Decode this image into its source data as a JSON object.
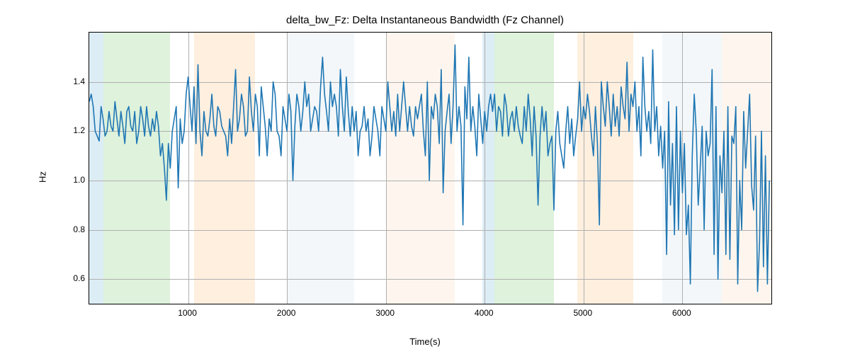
{
  "chart_data": {
    "type": "line",
    "title": "delta_bw_Fz: Delta Instantaneous Bandwidth (Fz Channel)",
    "xlabel": "Time(s)",
    "ylabel": "Hz",
    "xlim": [
      0,
      6900
    ],
    "ylim": [
      0.5,
      1.6
    ],
    "xticks": [
      1000,
      2000,
      3000,
      4000,
      5000,
      6000
    ],
    "yticks": [
      0.6,
      0.8,
      1.0,
      1.2,
      1.4
    ],
    "shaded_regions": [
      {
        "x0": 0,
        "x1": 140,
        "color": "#9ecae1"
      },
      {
        "x0": 140,
        "x1": 820,
        "color": "#a1d99b"
      },
      {
        "x0": 1060,
        "x1": 1680,
        "color": "#fdd0a2"
      },
      {
        "x0": 2000,
        "x1": 2680,
        "color": "#dce7ef"
      },
      {
        "x0": 3000,
        "x1": 3700,
        "color": "#fde6cf"
      },
      {
        "x0": 3980,
        "x1": 4100,
        "color": "#9ecae1"
      },
      {
        "x0": 4100,
        "x1": 4700,
        "color": "#a1d99b"
      },
      {
        "x0": 4940,
        "x1": 5500,
        "color": "#fdd0a2"
      },
      {
        "x0": 5800,
        "x1": 6400,
        "color": "#dce7ef"
      },
      {
        "x0": 6400,
        "x1": 6900,
        "color": "#fde6cf"
      }
    ],
    "series": [
      {
        "name": "delta_bw_Fz",
        "color": "#1f77b4",
        "x_step": 20,
        "values": [
          1.32,
          1.35,
          1.3,
          1.2,
          1.18,
          1.16,
          1.3,
          1.25,
          1.18,
          1.2,
          1.28,
          1.22,
          1.2,
          1.32,
          1.25,
          1.18,
          1.28,
          1.22,
          1.15,
          1.28,
          1.3,
          1.22,
          1.2,
          1.28,
          1.15,
          1.2,
          1.3,
          1.25,
          1.18,
          1.3,
          1.22,
          1.18,
          1.25,
          1.2,
          1.28,
          1.22,
          1.1,
          1.15,
          1.05,
          0.92,
          1.15,
          1.05,
          1.2,
          1.25,
          1.3,
          0.97,
          1.25,
          1.15,
          1.2,
          1.35,
          1.42,
          1.3,
          1.2,
          1.38,
          1.15,
          1.47,
          1.2,
          1.1,
          1.28,
          1.2,
          1.18,
          1.25,
          1.35,
          1.22,
          1.18,
          1.3,
          1.28,
          1.22,
          1.2,
          1.18,
          1.1,
          1.25,
          1.15,
          1.3,
          1.45,
          1.2,
          1.25,
          1.35,
          1.3,
          1.18,
          1.2,
          1.42,
          1.28,
          1.2,
          1.35,
          1.3,
          1.1,
          1.38,
          1.3,
          1.22,
          1.1,
          1.25,
          1.2,
          1.4,
          1.35,
          1.2,
          1.18,
          1.1,
          1.3,
          1.25,
          1.2,
          1.35,
          1.28,
          1.0,
          1.22,
          1.35,
          1.3,
          1.2,
          1.28,
          1.4,
          1.3,
          1.35,
          1.2,
          1.25,
          1.3,
          1.28,
          1.2,
          1.38,
          1.5,
          1.35,
          1.28,
          1.2,
          1.4,
          1.3,
          1.35,
          1.3,
          1.18,
          1.45,
          1.3,
          1.2,
          1.42,
          1.28,
          1.18,
          1.3,
          1.2,
          1.28,
          1.1,
          1.2,
          1.22,
          1.3,
          1.2,
          1.25,
          1.1,
          1.18,
          1.3,
          1.25,
          1.2,
          1.1,
          1.3,
          1.25,
          1.2,
          1.4,
          1.3,
          1.2,
          1.28,
          1.18,
          1.35,
          1.2,
          1.3,
          1.4,
          1.3,
          1.2,
          1.3,
          1.22,
          1.18,
          1.3,
          1.25,
          1.3,
          1.35,
          1.2,
          1.1,
          1.4,
          1.0,
          1.3,
          1.25,
          1.35,
          1.3,
          1.15,
          1.45,
          0.95,
          1.2,
          1.28,
          1.35,
          1.15,
          1.3,
          1.55,
          1.2,
          1.3,
          1.22,
          0.82,
          1.38,
          1.25,
          1.5,
          1.2,
          1.3,
          1.22,
          1.1,
          1.35,
          1.25,
          1.15,
          1.28,
          1.2,
          1.3,
          1.35,
          1.28,
          1.35,
          1.2,
          1.3,
          1.28,
          1.18,
          1.35,
          1.3,
          1.18,
          1.25,
          1.28,
          1.2,
          1.3,
          1.22,
          1.18,
          1.15,
          1.3,
          1.2,
          1.35,
          1.25,
          1.1,
          1.3,
          1.18,
          0.9,
          1.18,
          1.3,
          1.2,
          1.28,
          1.1,
          1.15,
          1.18,
          0.88,
          1.2,
          1.28,
          1.15,
          1.1,
          1.05,
          1.2,
          1.3,
          1.15,
          1.25,
          1.1,
          1.18,
          1.25,
          1.4,
          1.2,
          1.3,
          1.25,
          1.35,
          1.28,
          1.18,
          1.1,
          1.3,
          1.15,
          0.82,
          1.4,
          1.3,
          1.22,
          1.4,
          1.3,
          1.18,
          1.35,
          1.22,
          1.3,
          1.18,
          1.38,
          1.3,
          1.25,
          1.48,
          1.2,
          1.35,
          1.3,
          1.4,
          1.2,
          1.3,
          1.1,
          1.5,
          1.3,
          1.2,
          1.28,
          1.15,
          1.53,
          1.2,
          1.3,
          1.1,
          1.22,
          1.05,
          1.2,
          0.7,
          1.32,
          0.9,
          1.15,
          0.78,
          1.3,
          0.8,
          1.2,
          0.95,
          1.15,
          0.78,
          0.9,
          0.58,
          1.1,
          1.35,
          1.2,
          0.9,
          1.05,
          1.22,
          0.8,
          1.2,
          1.1,
          1.15,
          1.45,
          0.7,
          1.3,
          0.6,
          1.1,
          0.95,
          1.2,
          0.7,
          1.3,
          0.68,
          1.18,
          1.15,
          1.3,
          0.58,
          1.0,
          0.8,
          1.28,
          1.05,
          1.2,
          1.35,
          0.98,
          0.88,
          1.18,
          0.55,
          0.75,
          1.2,
          0.65,
          1.1,
          0.58,
          1.0
        ]
      }
    ]
  }
}
